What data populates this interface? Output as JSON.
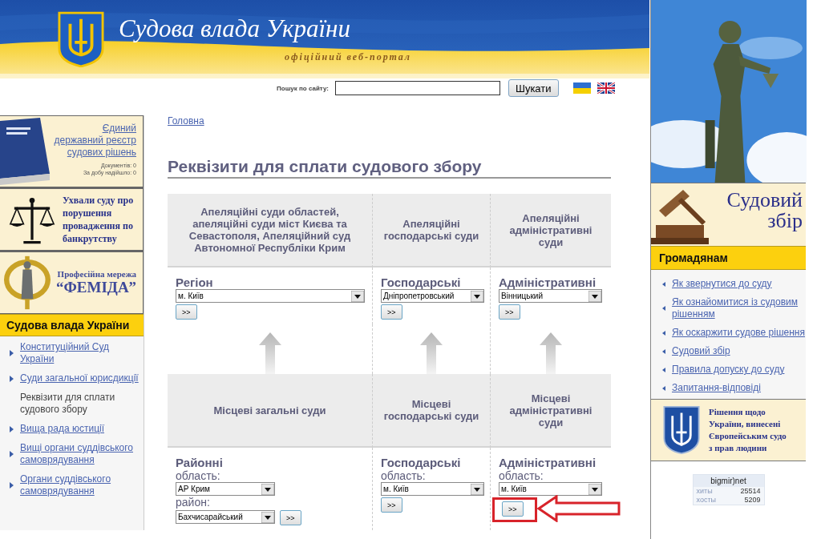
{
  "header": {
    "title": "Судова влада України",
    "subtitle": "офіційний веб-портал"
  },
  "search": {
    "label": "Пошук по сайту:",
    "button": "Шукати"
  },
  "left": {
    "registry": {
      "link": "Єдиний державний реєстр судових рішень",
      "stats": [
        "Документів: 0",
        "За добу надійшло: 0"
      ]
    },
    "bankruptcy": "Ухвали суду про порушення провадження по банкрутству",
    "femida": {
      "line1": "Професійна мережа",
      "line2": "“ФЕМІДА”"
    },
    "menu": {
      "title": "Судова влада України",
      "items": [
        {
          "label": "Конституційний Суд України",
          "selected": false
        },
        {
          "label": "Суди загальної юрисдикції",
          "selected": false
        },
        {
          "label": "Реквізити для сплати судового збору",
          "selected": true
        },
        {
          "label": "Вища рада юстиції",
          "selected": false
        },
        {
          "label": "Вищі органи суддівського самоврядування",
          "selected": false
        },
        {
          "label": "Органи суддівського самоврядування",
          "selected": false
        }
      ]
    }
  },
  "breadcrumb": "Головна",
  "heading": "Реквізити для сплати судового збору",
  "sections": [
    {
      "headers": [
        "Апеляційні суди областей, апеляційні суди міст Києва та Севастополя, Апеляційний суд Автономної Республіки Крим",
        "Апеляційні господарські суди",
        "Апеляційні адміністративні суди"
      ],
      "cells": [
        {
          "title": "Регіон",
          "items": [
            {
              "kind": "select",
              "value": "м. Київ"
            },
            {
              "kind": "button",
              "label": ">>",
              "highlighted": false
            }
          ]
        },
        {
          "title": "Господарські",
          "items": [
            {
              "kind": "select",
              "value": "Дніпропетровський"
            },
            {
              "kind": "button",
              "label": ">>",
              "highlighted": false
            }
          ]
        },
        {
          "title": "Адміністративні",
          "items": [
            {
              "kind": "select",
              "value": "Вінницький"
            },
            {
              "kind": "button",
              "label": ">>",
              "highlighted": false
            }
          ]
        }
      ]
    },
    {
      "headers": [
        "Місцеві загальні суди",
        "Місцеві господарські суди",
        "Місцеві адміністративні суди"
      ],
      "cells": [
        {
          "title": "Районні",
          "items": [
            {
              "kind": "label",
              "text": "область:"
            },
            {
              "kind": "select",
              "value": "АР Крим"
            },
            {
              "kind": "label",
              "text": "район:"
            },
            {
              "kind": "select",
              "value": "Бахчисарайський",
              "button": ">>"
            }
          ]
        },
        {
          "title": "Господарські",
          "items": [
            {
              "kind": "label",
              "text": "область:"
            },
            {
              "kind": "select",
              "value": "м. Київ"
            },
            {
              "kind": "button",
              "label": ">>",
              "highlighted": false
            }
          ]
        },
        {
          "title": "Адміністративні",
          "items": [
            {
              "kind": "label",
              "text": "область:"
            },
            {
              "kind": "select",
              "value": "м. Київ"
            },
            {
              "kind": "button",
              "label": ">>",
              "highlighted": true
            }
          ]
        }
      ]
    }
  ],
  "right": {
    "banner": {
      "line1": "Судовий",
      "line2": "збір"
    },
    "menu": {
      "title": "Громадянам",
      "items": [
        "Як звернутися до суду",
        "Як ознайомитися із судовим рішенням",
        "Як оскаржити судове рішення",
        "Судовий збір",
        "Правила допуску до суду",
        "Запитання-відповіді"
      ]
    },
    "echr": [
      "Рішення щодо",
      "України, винесені",
      "Європейським судо",
      "з прав людини"
    ],
    "counter": {
      "brand": "bigmir)net",
      "rows": [
        {
          "name": "хиты",
          "value": "25514"
        },
        {
          "name": "хосты",
          "value": "5209"
        }
      ]
    }
  }
}
